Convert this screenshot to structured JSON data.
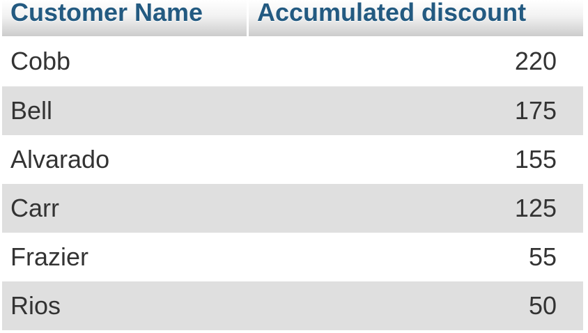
{
  "table": {
    "headers": [
      "Customer Name",
      "Accumulated discount"
    ],
    "rows": [
      {
        "name": "Cobb",
        "discount": "220"
      },
      {
        "name": "Bell",
        "discount": "175"
      },
      {
        "name": "Alvarado",
        "discount": "155"
      },
      {
        "name": "Carr",
        "discount": "125"
      },
      {
        "name": "Frazier",
        "discount": "55"
      },
      {
        "name": "Rios",
        "discount": "50"
      }
    ]
  }
}
